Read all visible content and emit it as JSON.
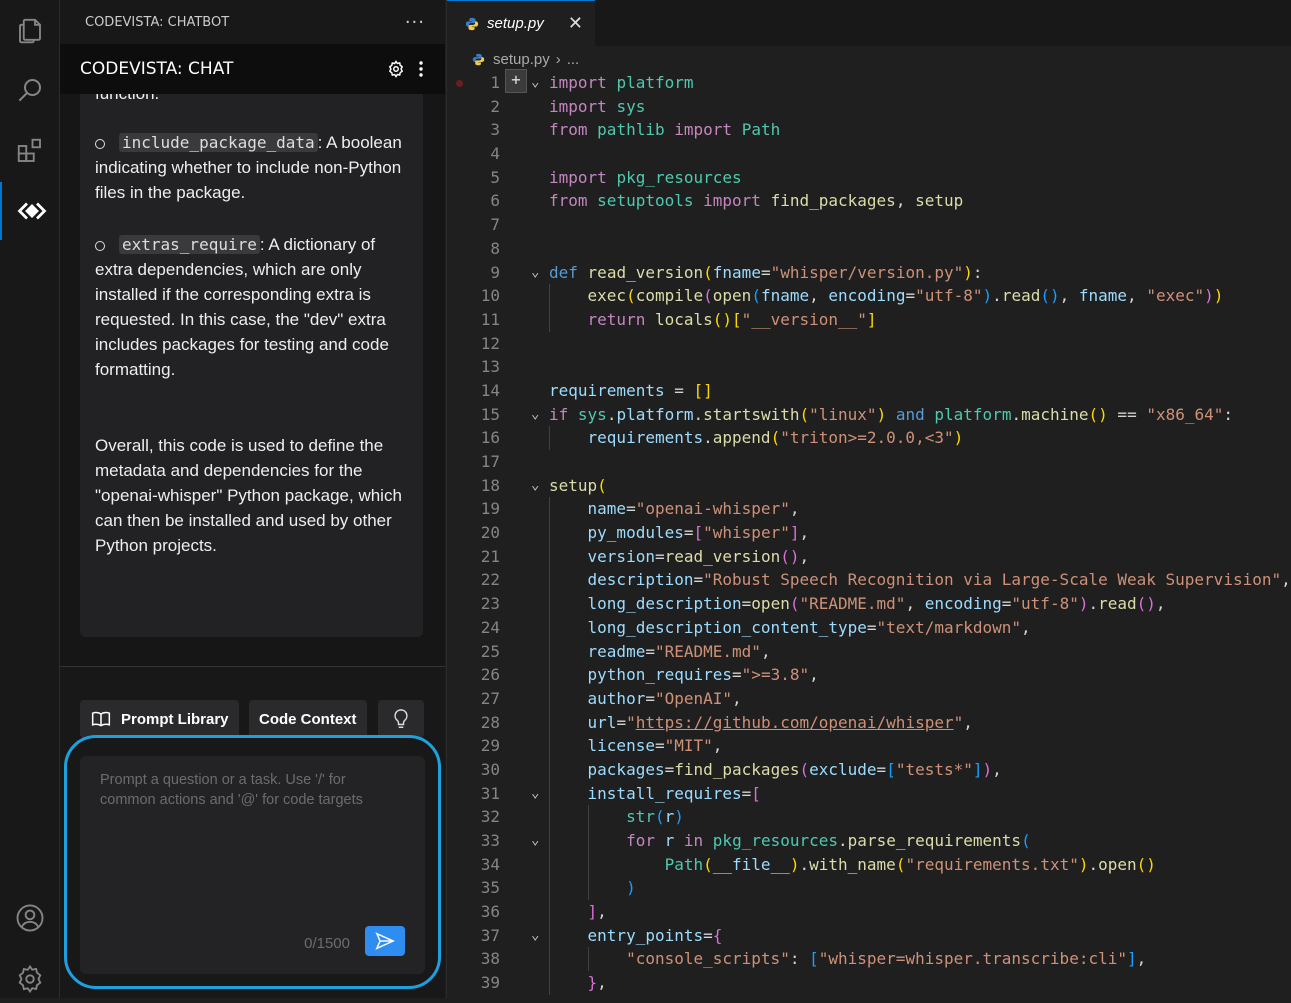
{
  "sidebar": {
    "header": "CODEVISTA: CHATBOT",
    "more": "···",
    "chat_title": "CODEVISTA: CHAT"
  },
  "message": {
    "top_fragment": "function.",
    "bullets": [
      {
        "code": "include_package_data",
        "text": ": A boolean indicating whether to include non-Python files in the package."
      },
      {
        "code": "extras_require",
        "text": ": A dictionary of extra dependencies, which are only installed if the corresponding extra is requested. In this case, the \"dev\" extra includes packages for testing and code formatting."
      }
    ],
    "summary": "Overall, this code is used to define the metadata and dependencies for the \"openai-whisper\" Python package, which can then be installed and used by other Python projects."
  },
  "toolbar": {
    "prompt_library": "Prompt Library",
    "code_context": "Code Context"
  },
  "prompt": {
    "placeholder": "Prompt a question or a task. Use '/' for common actions and '@' for code targets",
    "counter": "0/1500"
  },
  "editor": {
    "tab_name": "setup.py",
    "breadcrumb_file": "setup.py",
    "breadcrumb_rest": "...",
    "line_numbers": [
      "1",
      "2",
      "3",
      "4",
      "5",
      "6",
      "7",
      "8",
      "9",
      "10",
      "11",
      "12",
      "13",
      "14",
      "15",
      "16",
      "17",
      "18",
      "19",
      "20",
      "21",
      "22",
      "23",
      "24",
      "25",
      "26",
      "27",
      "28",
      "29",
      "30",
      "31",
      "32",
      "33",
      "34",
      "35",
      "36",
      "37",
      "38",
      "39"
    ]
  },
  "colors": {
    "accent": "#0078d4",
    "send_button": "#2f8cf0",
    "highlight_ring": "#1ea0df"
  },
  "icons": [
    "files-icon",
    "search-icon",
    "extensions-icon",
    "codevista-icon",
    "account-icon",
    "settings-gear-icon",
    "gear-icon",
    "kebab-icon",
    "python-file-icon",
    "close-icon",
    "book-icon",
    "lightbulb-icon",
    "send-icon",
    "like-icon",
    "dislike-icon",
    "inspect-icon"
  ]
}
